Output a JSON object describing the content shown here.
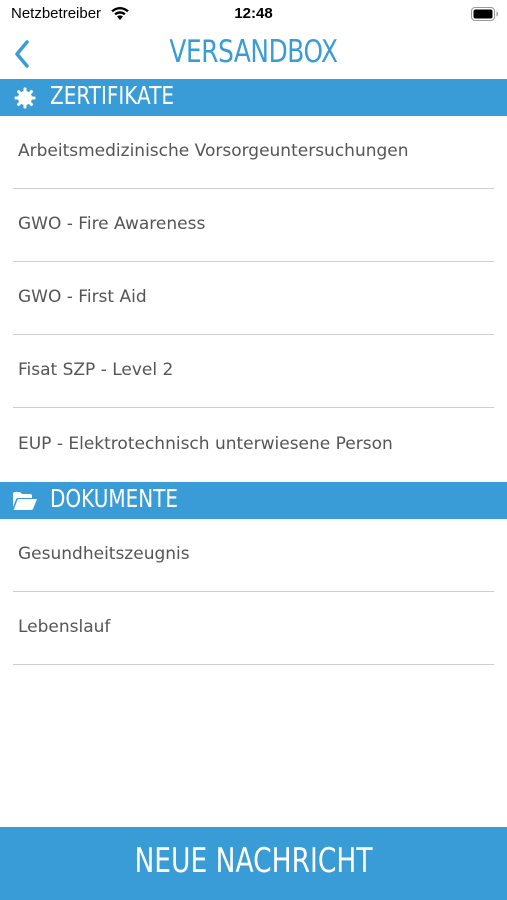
{
  "status_bar": {
    "carrier": "Netzbetreiber",
    "time": "12:48",
    "wifi_icon": "wifi-icon",
    "battery_icon": "battery-icon"
  },
  "nav": {
    "back_icon": "chevron-left-icon",
    "title": "VERSANDBOX"
  },
  "sections": [
    {
      "icon": "badge-icon",
      "title": "ZERTIFIKATE",
      "items": [
        "Arbeitsmedizinische Vorsorgeuntersuchungen",
        "GWO - Fire Awareness",
        "GWO - First Aid",
        "Fisat SZP - Level 2",
        "EUP - Elektrotechnisch unterwiesene Person"
      ]
    },
    {
      "icon": "folder-open-icon",
      "title": "DOKUMENTE",
      "items": [
        "Gesundheitszeugnis",
        "Lebenslauf"
      ]
    }
  ],
  "footer": {
    "button_label": "NEUE NACHRICHT"
  },
  "colors": {
    "accent": "#3a9cd6",
    "text": "#555555",
    "divider": "#cfcfcf"
  }
}
